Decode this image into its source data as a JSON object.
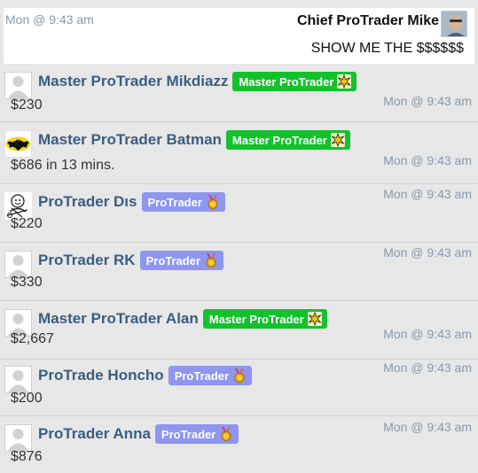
{
  "top_message": {
    "time": "Mon @ 9:43 am",
    "author": "Chief ProTrader Mike",
    "text": "SHOW ME THE $$$$$$"
  },
  "messages": [
    {
      "name": "Master ProTrader Mikdiazz",
      "badge": "Master ProTrader",
      "amount": "$230",
      "time": "Mon @ 9:43 am"
    },
    {
      "name": "Master ProTrader Batman",
      "badge": "Master ProTrader",
      "amount": "$686 in 13 mins.",
      "time": "Mon @ 9:43 am"
    },
    {
      "name": "ProTrader Dıs",
      "badge": "ProTrader",
      "amount": "$220",
      "time": "Mon @ 9:43 am"
    },
    {
      "name": "ProTrader RK",
      "badge": "ProTrader",
      "amount": "$330",
      "time": "Mon @ 9:43 am"
    },
    {
      "name": "Master ProTrader Alan",
      "badge": "Master ProTrader",
      "amount": "$2,667",
      "time": "Mon @ 9:43 am"
    },
    {
      "name": "ProTrade Honcho",
      "badge": "ProTrader",
      "amount": "$200",
      "time": "Mon @ 9:43 am"
    },
    {
      "name": "ProTrader Anna",
      "badge": "ProTrader",
      "amount": "$876",
      "time": "Mon @ 9:43 am"
    }
  ],
  "colors": {
    "master_badge": "#13c12c",
    "protrader_badge": "#8e96f0",
    "name": "#3a5d80",
    "timestamp": "#8a99ab"
  },
  "icons": {
    "master_badge_icon": "star-burst-icon",
    "protrader_badge_icon": "medal-icon",
    "default_avatar": "default-avatar-icon",
    "batman_avatar": "batman-logo-icon"
  }
}
